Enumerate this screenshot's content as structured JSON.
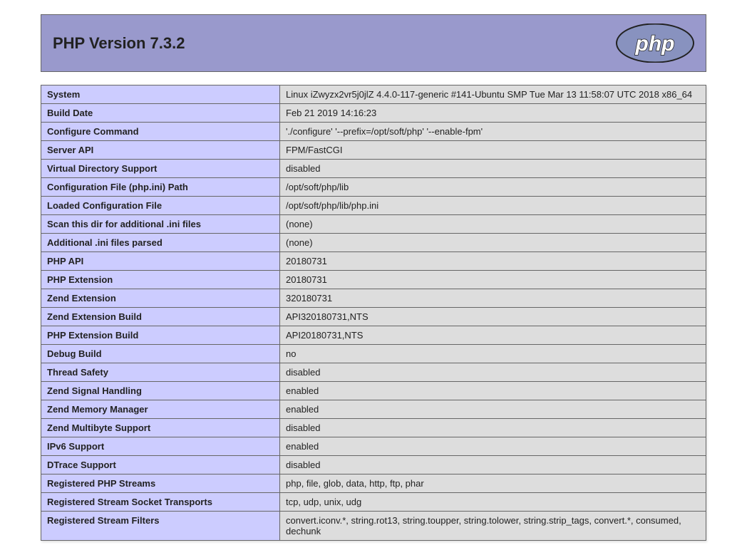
{
  "title": "PHP Version 7.3.2",
  "logoText": "php",
  "rows": [
    {
      "label": "System",
      "value": "Linux iZwyzx2vr5j0jlZ 4.4.0-117-generic #141-Ubuntu SMP Tue Mar 13 11:58:07 UTC 2018 x86_64"
    },
    {
      "label": "Build Date",
      "value": "Feb 21 2019 14:16:23"
    },
    {
      "label": "Configure Command",
      "value": "'./configure' '--prefix=/opt/soft/php' '--enable-fpm'"
    },
    {
      "label": "Server API",
      "value": "FPM/FastCGI"
    },
    {
      "label": "Virtual Directory Support",
      "value": "disabled"
    },
    {
      "label": "Configuration File (php.ini) Path",
      "value": "/opt/soft/php/lib"
    },
    {
      "label": "Loaded Configuration File",
      "value": "/opt/soft/php/lib/php.ini"
    },
    {
      "label": "Scan this dir for additional .ini files",
      "value": "(none)"
    },
    {
      "label": "Additional .ini files parsed",
      "value": "(none)"
    },
    {
      "label": "PHP API",
      "value": "20180731"
    },
    {
      "label": "PHP Extension",
      "value": "20180731"
    },
    {
      "label": "Zend Extension",
      "value": "320180731"
    },
    {
      "label": "Zend Extension Build",
      "value": "API320180731,NTS"
    },
    {
      "label": "PHP Extension Build",
      "value": "API20180731,NTS"
    },
    {
      "label": "Debug Build",
      "value": "no"
    },
    {
      "label": "Thread Safety",
      "value": "disabled"
    },
    {
      "label": "Zend Signal Handling",
      "value": "enabled"
    },
    {
      "label": "Zend Memory Manager",
      "value": "enabled"
    },
    {
      "label": "Zend Multibyte Support",
      "value": "disabled"
    },
    {
      "label": "IPv6 Support",
      "value": "enabled"
    },
    {
      "label": "DTrace Support",
      "value": "disabled"
    },
    {
      "label": "Registered PHP Streams",
      "value": "php, file, glob, data, http, ftp, phar"
    },
    {
      "label": "Registered Stream Socket Transports",
      "value": "tcp, udp, unix, udg"
    },
    {
      "label": "Registered Stream Filters",
      "value": "convert.iconv.*, string.rot13, string.toupper, string.tolower, string.strip_tags, convert.*, consumed, dechunk"
    }
  ]
}
